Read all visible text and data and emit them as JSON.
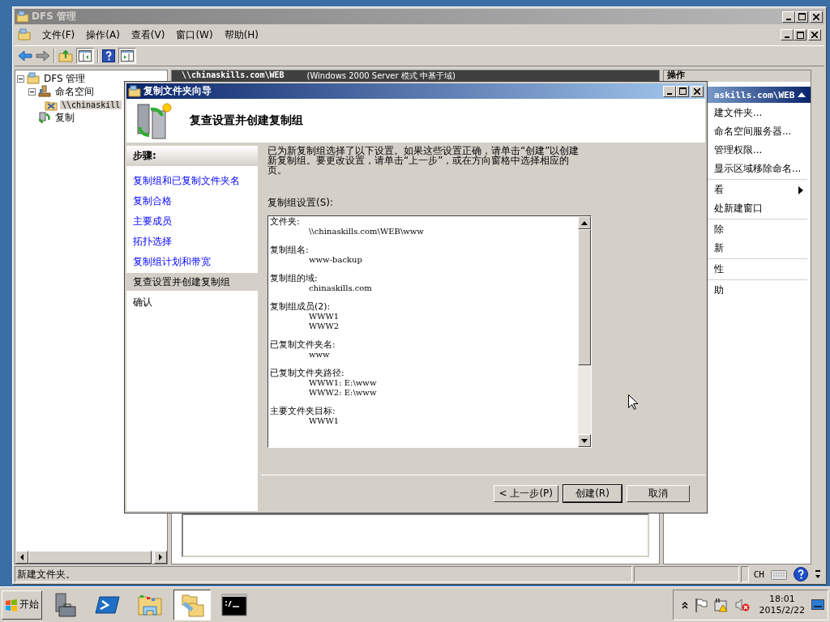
{
  "main_window": {
    "title": "DFS 管理",
    "menu": [
      "文件(F)",
      "操作(A)",
      "查看(V)",
      "窗口(W)",
      "帮助(H)"
    ],
    "tree": [
      {
        "label": "DFS 管理",
        "kind": "root",
        "selected": false,
        "expanded": true,
        "children": [
          {
            "label": "命名空间",
            "kind": "namespaces",
            "selected": false,
            "expanded": true,
            "children": [
              {
                "label": "\\\\chinaskill",
                "kind": "namespace",
                "selected": true
              }
            ]
          },
          {
            "label": "复制",
            "kind": "replication",
            "selected": false
          }
        ]
      }
    ],
    "center_header": {
      "path": "\\\\chinaskills.com\\WEB",
      "mode": "(Windows 2000 Server 模式 中基于域)"
    },
    "actions": {
      "title": "操作",
      "group": "askills.com\\WEB",
      "sections": [
        [
          {
            "label": "建文件夹...",
            "submenu": false
          },
          {
            "label": "命名空间服务器...",
            "submenu": false
          },
          {
            "label": "管理权限...",
            "submenu": false
          },
          {
            "label": "显示区域移除命名...",
            "submenu": false
          }
        ],
        [
          {
            "label": "看",
            "submenu": true
          },
          {
            "label": "处新建窗口",
            "submenu": false
          }
        ],
        [
          {
            "label": "除",
            "submenu": false
          },
          {
            "label": "新",
            "submenu": false
          }
        ],
        [
          {
            "label": "性",
            "submenu": false
          }
        ],
        [
          {
            "label": "助",
            "submenu": false
          }
        ]
      ]
    },
    "status_bar": {
      "text": "新建文件夹。",
      "language": "CH"
    }
  },
  "wizard": {
    "title": "复制文件夹向导",
    "heading": "复查设置并创建复制组",
    "steps_title": "步骤:",
    "steps": [
      {
        "label": "复制组和已复制文件夹名",
        "kind": "link",
        "selected": false
      },
      {
        "label": "复制合格",
        "kind": "link",
        "selected": false
      },
      {
        "label": "主要成员",
        "kind": "link",
        "selected": false
      },
      {
        "label": "拓扑选择",
        "kind": "link",
        "selected": false
      },
      {
        "label": "复制组计划和带宽",
        "kind": "link",
        "selected": false
      },
      {
        "label": "复查设置并创建复制组",
        "kind": "plain",
        "selected": true
      },
      {
        "label": "确认",
        "kind": "plain",
        "selected": false
      }
    ],
    "description": "已为新复制组选择了以下设置。如果这些设置正确，请单击“创建”以创建新复制组。要更改设置，请单击“上一步”，或在方向窗格中选择相应的页。",
    "settings_label": "复制组设置(S):",
    "settings": [
      {
        "label": "文件夹:",
        "values": [
          "\\\\chinaskills.com\\WEB\\www"
        ]
      },
      {
        "label": "复制组名:",
        "values": [
          "www-backup"
        ]
      },
      {
        "label": "复制组的域:",
        "values": [
          "chinaskills.com"
        ]
      },
      {
        "label": "复制组成员(2):",
        "values": [
          "WWW1",
          "WWW2"
        ]
      },
      {
        "label": "已复制文件夹名:",
        "values": [
          "www"
        ]
      },
      {
        "label": "已复制文件夹路径:",
        "values": [
          "WWW1: E:\\www",
          "WWW2: E:\\www"
        ]
      },
      {
        "label": "主要文件夹目标:",
        "values": [
          "WWW1"
        ]
      }
    ],
    "buttons": [
      {
        "label": "< 上一步(P)",
        "default": false
      },
      {
        "label": "创建(R)",
        "default": true
      },
      {
        "label": "取消",
        "default": false
      }
    ]
  },
  "taskbar": {
    "start": "开始",
    "apps": [
      {
        "kind": "server-manager",
        "selected": false
      },
      {
        "kind": "powershell",
        "selected": false
      },
      {
        "kind": "explorer",
        "selected": false
      },
      {
        "kind": "dfs",
        "selected": true
      },
      {
        "kind": "console",
        "selected": false
      }
    ],
    "time": "18:01",
    "date": "2015/2/22"
  }
}
